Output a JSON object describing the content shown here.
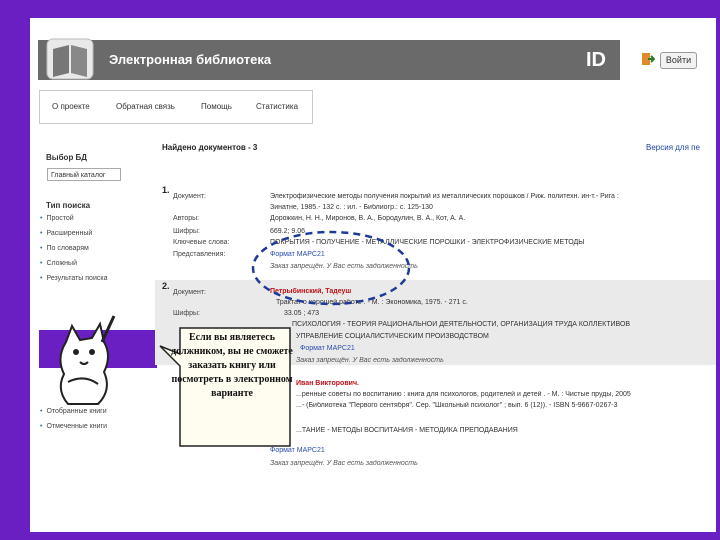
{
  "header": {
    "title": "Электронная библиотека",
    "brand": "ID",
    "login": "Войти"
  },
  "nav": {
    "items": [
      "О проекте",
      "Обратная связь",
      "Помощь",
      "Статистика"
    ]
  },
  "sidebar": {
    "db_title": "Выбор БД",
    "db_select": "Главный каталог",
    "search_title": "Тип поиска",
    "search_items": [
      "Простой",
      "Расширенный",
      "По словарям",
      "Сложный",
      "Результаты поиска"
    ],
    "bottom_items": [
      "Отобранные книги",
      "Отмеченные книги"
    ]
  },
  "results": {
    "found": "Найдено документов - 3",
    "version": "Версия для пе"
  },
  "entries": [
    {
      "num": "1.",
      "labels": [
        "Документ:",
        "Авторы:",
        "Шифры:",
        "Ключевые слова:",
        "Представления:"
      ],
      "lines": [
        "Электрофизические методы получения покрытий из металлических порошков / Риж. политехн. ин-т.- Рига :",
        "Зинатне, 1985.- 132 с. : ил. - Библиогр.: с. 125-130",
        "Дорожкин, Н. Н., Миронов, В. А., Бородулин, В. А., Кот, А. А.",
        "669.2; 9.06",
        "ПОКРЫТИЯ - ПОЛУЧЕНИЕ - МЕТАЛЛИЧЕСКИЕ ПОРОШКИ - ЭЛЕКТРОФИЗИЧЕСКИЕ МЕТОДЫ",
        "Формат МАРС21",
        "Заказ запрещён. У Вас есть задолженность"
      ]
    },
    {
      "num": "2.",
      "labels": [
        "Документ:",
        "Шифры:"
      ],
      "lines": [
        "Петрыбинский, Тадеуш",
        "Трактат о хорошей работе . - М. : Экономика, 1975. - 271 с.",
        "33.05 ; 473",
        "ПСИХОЛОГИЯ - ТЕОРИЯ РАЦИОНАЛЬНОЙ ДЕЯТЕЛЬНОСТИ, ОРГАНИЗАЦИЯ ТРУДА КОЛЛЕКТИВОВ",
        "УПРАВЛЕНИЕ СОЦИАЛИСТИЧЕСКИМ ПРОИЗВОДСТВОМ",
        "Формат МАРС21",
        "Заказ запрещён. У Вас есть задолженность"
      ]
    },
    {
      "num": "3.",
      "lines": [
        "Иван Викторович.",
        "...ренные советы по воспитанию : книга для психологов, родителей и детей . - М. : Чистые пруды, 2005",
        "...- (Библиотека \"Первого сентября\". Сер. \"Школьный психолог\" ; вып. 6 (12)). - ISBN 5-9667-0267-3",
        "...ТАНИЕ - МЕТОДЫ ВОСПИТАНИЯ - МЕТОДИКА ПРЕПОДАВАНИЯ",
        "Формат МАРС21",
        "Заказ запрещён. У Вас есть задолженность"
      ]
    }
  ],
  "callout": {
    "text": "Если вы являетесь должником, вы не сможете заказать книгу или посмотреть в электронном варианте"
  }
}
